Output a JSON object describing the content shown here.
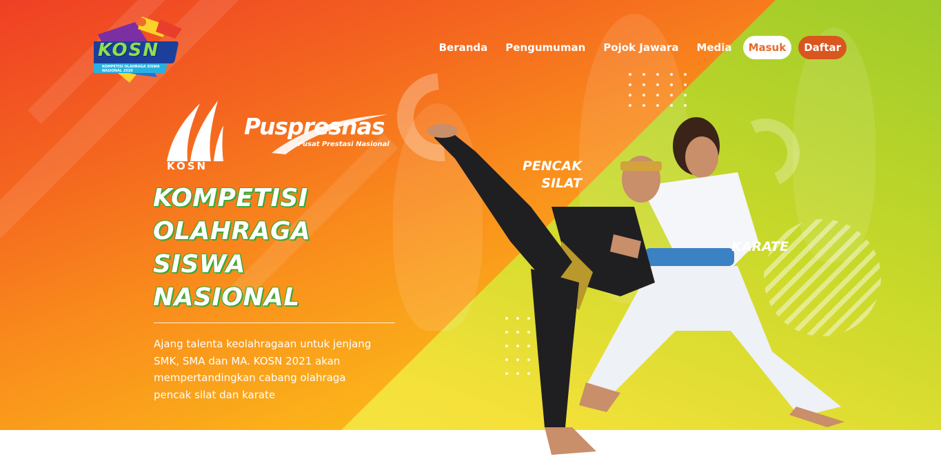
{
  "brand": {
    "logo_text": "KOSN",
    "logo_subtext": "KOMPETISI OLAHRAGA SISWA NASIONAL 2020",
    "mark_text": "KOSN",
    "partner_name": "Puspresnas",
    "partner_tagline": "Pusat Prestasi Nasional"
  },
  "nav": {
    "items": [
      {
        "label": "Beranda"
      },
      {
        "label": "Pengumuman"
      },
      {
        "label": "Pojok Jawara"
      },
      {
        "label": "Media"
      }
    ],
    "login_label": "Masuk",
    "register_label": "Daftar"
  },
  "hero": {
    "headline": [
      "KOMPETISI",
      "OLAHRAGA",
      "SISWA",
      "NASIONAL"
    ],
    "description": "Ajang talenta keolahragaan untuk jenjang SMK, SMA dan MA. KOSN 2021 akan mempertandingkan cabang olahraga pencak silat dan karate",
    "sport_labels": {
      "pencak_line1": "PENCAK",
      "pencak_line2": "SILAT",
      "karate": "KARATE"
    }
  },
  "colors": {
    "orange_red": "#ef3f25",
    "orange": "#f98a1c",
    "yellow": "#fdd51f",
    "lime": "#9fcb2a",
    "headline_outline": "#3aa935",
    "register_button": "#d9561e"
  },
  "icons": [
    "kosn-logo-icon",
    "kosn-mark-icon",
    "puspresnas-swoosh-icon"
  ]
}
